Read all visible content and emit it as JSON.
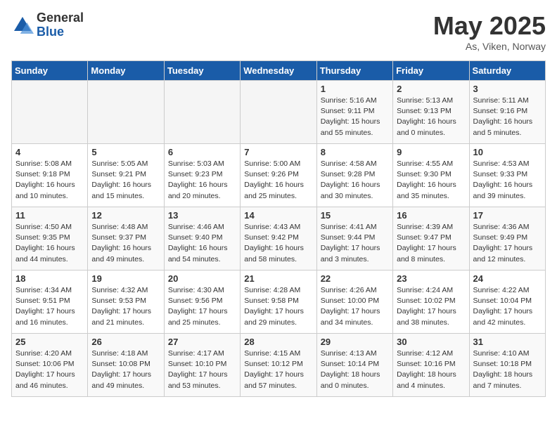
{
  "header": {
    "logo_general": "General",
    "logo_blue": "Blue",
    "month": "May 2025",
    "location": "As, Viken, Norway"
  },
  "weekdays": [
    "Sunday",
    "Monday",
    "Tuesday",
    "Wednesday",
    "Thursday",
    "Friday",
    "Saturday"
  ],
  "weeks": [
    [
      {
        "day": "",
        "info": ""
      },
      {
        "day": "",
        "info": ""
      },
      {
        "day": "",
        "info": ""
      },
      {
        "day": "",
        "info": ""
      },
      {
        "day": "1",
        "info": "Sunrise: 5:16 AM\nSunset: 9:11 PM\nDaylight: 15 hours\nand 55 minutes."
      },
      {
        "day": "2",
        "info": "Sunrise: 5:13 AM\nSunset: 9:13 PM\nDaylight: 16 hours\nand 0 minutes."
      },
      {
        "day": "3",
        "info": "Sunrise: 5:11 AM\nSunset: 9:16 PM\nDaylight: 16 hours\nand 5 minutes."
      }
    ],
    [
      {
        "day": "4",
        "info": "Sunrise: 5:08 AM\nSunset: 9:18 PM\nDaylight: 16 hours\nand 10 minutes."
      },
      {
        "day": "5",
        "info": "Sunrise: 5:05 AM\nSunset: 9:21 PM\nDaylight: 16 hours\nand 15 minutes."
      },
      {
        "day": "6",
        "info": "Sunrise: 5:03 AM\nSunset: 9:23 PM\nDaylight: 16 hours\nand 20 minutes."
      },
      {
        "day": "7",
        "info": "Sunrise: 5:00 AM\nSunset: 9:26 PM\nDaylight: 16 hours\nand 25 minutes."
      },
      {
        "day": "8",
        "info": "Sunrise: 4:58 AM\nSunset: 9:28 PM\nDaylight: 16 hours\nand 30 minutes."
      },
      {
        "day": "9",
        "info": "Sunrise: 4:55 AM\nSunset: 9:30 PM\nDaylight: 16 hours\nand 35 minutes."
      },
      {
        "day": "10",
        "info": "Sunrise: 4:53 AM\nSunset: 9:33 PM\nDaylight: 16 hours\nand 39 minutes."
      }
    ],
    [
      {
        "day": "11",
        "info": "Sunrise: 4:50 AM\nSunset: 9:35 PM\nDaylight: 16 hours\nand 44 minutes."
      },
      {
        "day": "12",
        "info": "Sunrise: 4:48 AM\nSunset: 9:37 PM\nDaylight: 16 hours\nand 49 minutes."
      },
      {
        "day": "13",
        "info": "Sunrise: 4:46 AM\nSunset: 9:40 PM\nDaylight: 16 hours\nand 54 minutes."
      },
      {
        "day": "14",
        "info": "Sunrise: 4:43 AM\nSunset: 9:42 PM\nDaylight: 16 hours\nand 58 minutes."
      },
      {
        "day": "15",
        "info": "Sunrise: 4:41 AM\nSunset: 9:44 PM\nDaylight: 17 hours\nand 3 minutes."
      },
      {
        "day": "16",
        "info": "Sunrise: 4:39 AM\nSunset: 9:47 PM\nDaylight: 17 hours\nand 8 minutes."
      },
      {
        "day": "17",
        "info": "Sunrise: 4:36 AM\nSunset: 9:49 PM\nDaylight: 17 hours\nand 12 minutes."
      }
    ],
    [
      {
        "day": "18",
        "info": "Sunrise: 4:34 AM\nSunset: 9:51 PM\nDaylight: 17 hours\nand 16 minutes."
      },
      {
        "day": "19",
        "info": "Sunrise: 4:32 AM\nSunset: 9:53 PM\nDaylight: 17 hours\nand 21 minutes."
      },
      {
        "day": "20",
        "info": "Sunrise: 4:30 AM\nSunset: 9:56 PM\nDaylight: 17 hours\nand 25 minutes."
      },
      {
        "day": "21",
        "info": "Sunrise: 4:28 AM\nSunset: 9:58 PM\nDaylight: 17 hours\nand 29 minutes."
      },
      {
        "day": "22",
        "info": "Sunrise: 4:26 AM\nSunset: 10:00 PM\nDaylight: 17 hours\nand 34 minutes."
      },
      {
        "day": "23",
        "info": "Sunrise: 4:24 AM\nSunset: 10:02 PM\nDaylight: 17 hours\nand 38 minutes."
      },
      {
        "day": "24",
        "info": "Sunrise: 4:22 AM\nSunset: 10:04 PM\nDaylight: 17 hours\nand 42 minutes."
      }
    ],
    [
      {
        "day": "25",
        "info": "Sunrise: 4:20 AM\nSunset: 10:06 PM\nDaylight: 17 hours\nand 46 minutes."
      },
      {
        "day": "26",
        "info": "Sunrise: 4:18 AM\nSunset: 10:08 PM\nDaylight: 17 hours\nand 49 minutes."
      },
      {
        "day": "27",
        "info": "Sunrise: 4:17 AM\nSunset: 10:10 PM\nDaylight: 17 hours\nand 53 minutes."
      },
      {
        "day": "28",
        "info": "Sunrise: 4:15 AM\nSunset: 10:12 PM\nDaylight: 17 hours\nand 57 minutes."
      },
      {
        "day": "29",
        "info": "Sunrise: 4:13 AM\nSunset: 10:14 PM\nDaylight: 18 hours\nand 0 minutes."
      },
      {
        "day": "30",
        "info": "Sunrise: 4:12 AM\nSunset: 10:16 PM\nDaylight: 18 hours\nand 4 minutes."
      },
      {
        "day": "31",
        "info": "Sunrise: 4:10 AM\nSunset: 10:18 PM\nDaylight: 18 hours\nand 7 minutes."
      }
    ]
  ]
}
